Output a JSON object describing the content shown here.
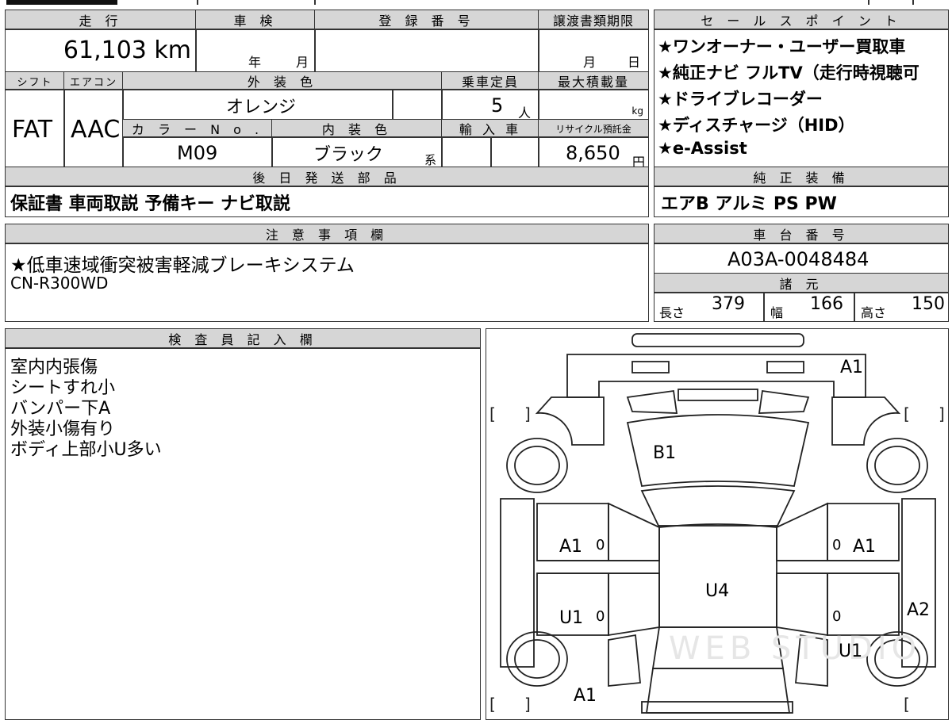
{
  "top": {
    "mileage_label": "走 行",
    "mileage_value": "61,103 km",
    "shaken_label": "車 検",
    "shaken_year": "年",
    "shaken_month": "月",
    "reg_label": "登 録 番 号",
    "transfer_label": "譲渡書類期限",
    "transfer_month": "月",
    "transfer_day": "日",
    "shift_label": "シフト",
    "shift_value": "FAT",
    "ac_label": "エアコン",
    "ac_value": "AAC",
    "ext_color_label": "外 装 色",
    "ext_color_value": "オレンジ",
    "capacity_label": "乗車定員",
    "capacity_value": "5",
    "capacity_unit": "人",
    "load_label": "最大積載量",
    "load_unit": "kg",
    "color_no_label": "カ ラ ー N o .",
    "color_no_value": "M09",
    "int_color_label": "内 装 色",
    "int_color_value": "ブラック",
    "int_color_suffix": "系",
    "import_label": "輸 入 車",
    "recycle_label": "リサイクル預託金",
    "recycle_value": "8,650",
    "recycle_unit": "円",
    "later_label": "後 日 発 送 部 品",
    "later_value": "保証書 車両取説 予備キー ナビ取説"
  },
  "sales": {
    "label": "セ ー ル ス ポ イ ン ト",
    "points": [
      "★ワンオーナー・ユーザー買取車",
      "★純正ナビ フルTV（走行時視聴可",
      "★ドライブレコーダー",
      "★ディスチャージ（HID）",
      "★e-Assist"
    ]
  },
  "equipment": {
    "label": "純 正 装 備",
    "value": "エアB アルミ PS PW"
  },
  "notes": {
    "label": "注 意 事 項 欄",
    "lines": [
      "★低車速域衝突被害軽減ブレーキシステム",
      "CN-R300WD"
    ]
  },
  "chassis": {
    "label": "車 台 番 号",
    "value": "A03A-0048484"
  },
  "specs": {
    "label": "諸 元",
    "length_label": "長さ",
    "length_value": "379",
    "width_label": "幅",
    "width_value": "166",
    "height_label": "高さ",
    "height_value": "150"
  },
  "inspector": {
    "label": "検 査 員 記 入 欄",
    "lines": [
      "室内内張傷",
      "シートすれ小",
      "バンパー下A",
      "外装小傷有り",
      "ボディ上部小U多い"
    ]
  },
  "diagram": {
    "marks": {
      "front": "A1",
      "hood": "B1",
      "left_front_door": "A1",
      "right_front_door": "A1",
      "roof": "U4",
      "left_rear_door": "U1",
      "right_rear_fender": "A2",
      "right_rear": "U1",
      "rear": "A1",
      "zero": "0"
    },
    "watermark": "WEB STUDIO"
  }
}
